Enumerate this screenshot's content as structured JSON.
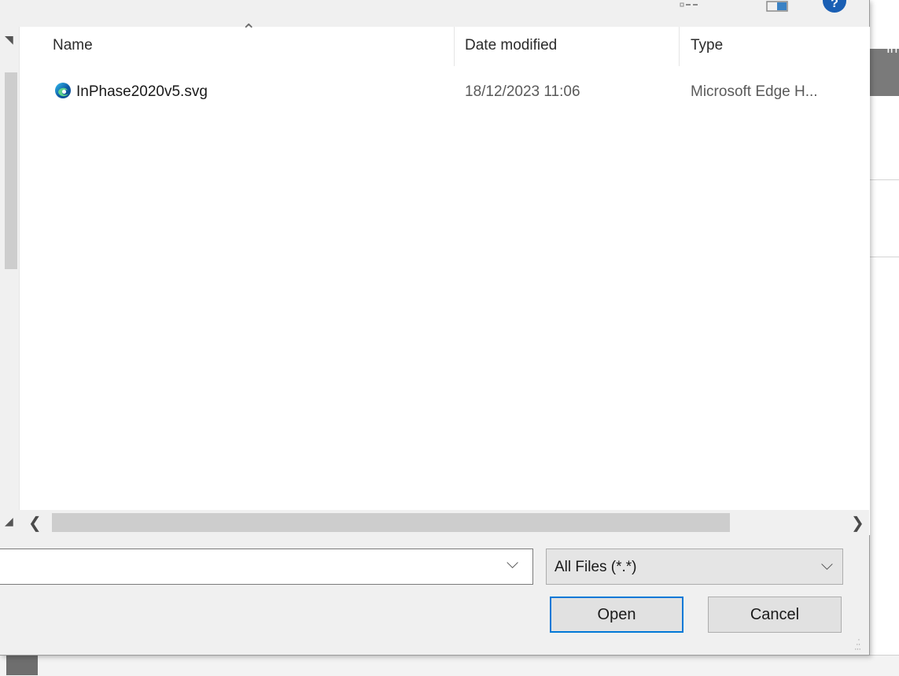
{
  "background_app": {
    "strip_text": "In"
  },
  "file_list": {
    "columns": {
      "name": "Name",
      "date_modified": "Date modified",
      "type": "Type"
    },
    "files": [
      {
        "name": "InPhase2020v5.svg",
        "date_modified": "18/12/2023 11:06",
        "type": "Microsoft Edge H...",
        "icon": "edge-icon"
      }
    ]
  },
  "footer": {
    "file_name_value": "",
    "file_type_selected": "All Files (*.*)",
    "open_label": "Open",
    "cancel_label": "Cancel"
  },
  "colors": {
    "accent": "#0078d7",
    "help_icon": "#1a5fb4"
  }
}
